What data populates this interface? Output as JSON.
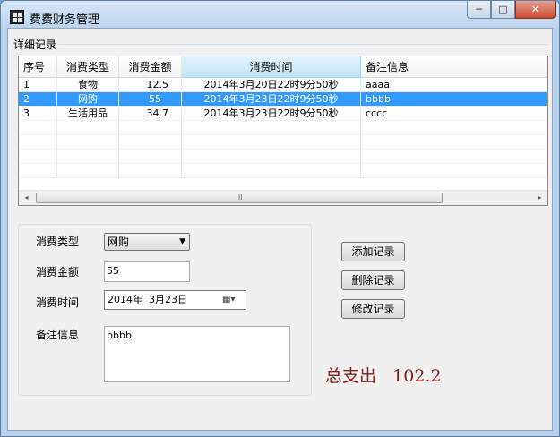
{
  "window": {
    "title": "费费财务管理",
    "controls": {
      "minimize": "─",
      "maximize": "□",
      "close": "✕"
    }
  },
  "details": {
    "group_title": "详细记录",
    "columns": [
      "序号",
      "消费类型",
      "消费金额",
      "消费时间",
      "备注信息"
    ],
    "rows": [
      {
        "id": "1",
        "type": "食物",
        "amount": "12.5",
        "time": "2014年3月20日22时9分50秒",
        "note": "aaaa",
        "selected": false
      },
      {
        "id": "2",
        "type": "网购",
        "amount": "55",
        "time": "2014年3月23日22时9分50秒",
        "note": "bbbb",
        "selected": true
      },
      {
        "id": "3",
        "type": "生活用品",
        "amount": "34.7",
        "time": "2014年3月23日22时9分50秒",
        "note": "cccc",
        "selected": false
      }
    ],
    "scrollbar": {
      "left_arrow": "◂",
      "right_arrow": "▸",
      "grip": "III"
    }
  },
  "form": {
    "type_label": "消费类型",
    "type_value": "网购",
    "amount_label": "消费金额",
    "amount_value": "55",
    "time_label": "消费时间",
    "time_value": "2014年  3月23日",
    "note_label": "备注信息",
    "note_value": "bbbb"
  },
  "buttons": {
    "add": "添加记录",
    "delete": "删除记录",
    "edit": "修改记录"
  },
  "summary": {
    "label": "总支出",
    "value": "102.2"
  },
  "colors": {
    "selection": "#3399ff",
    "total_text": "#8b1a1a"
  }
}
